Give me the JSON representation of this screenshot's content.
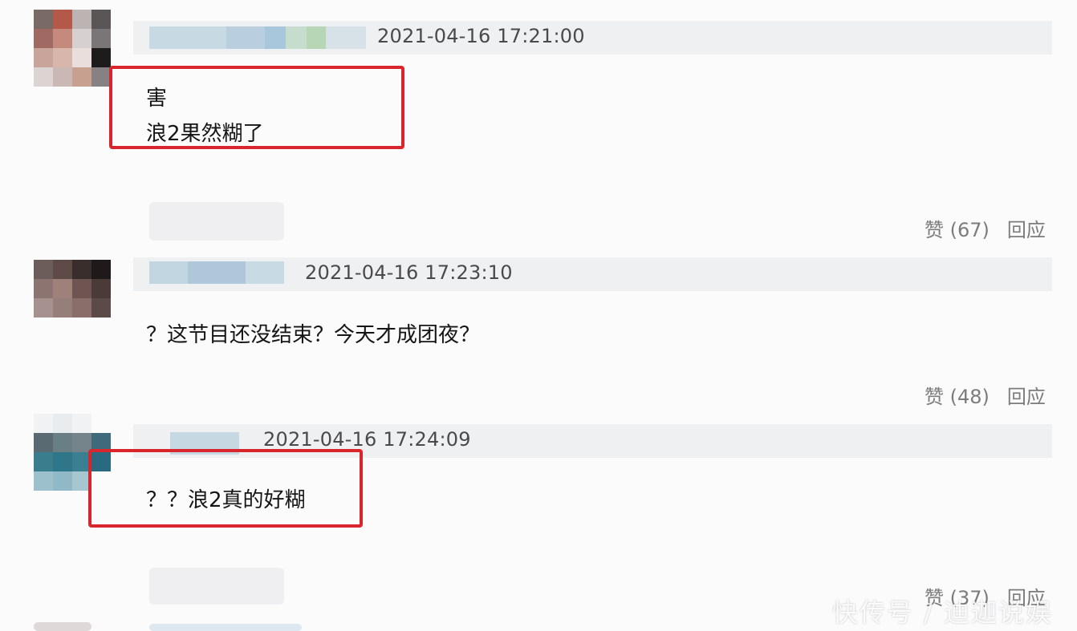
{
  "comments": [
    {
      "timestamp": "2021-04-16 17:21:00",
      "lines": [
        "害",
        "浪2果然糊了"
      ],
      "likes": "赞 (67)",
      "reply": "回应"
    },
    {
      "timestamp": "2021-04-16 17:23:10",
      "lines": [
        "？这节目还没结束？今天才成团夜？"
      ],
      "likes": "赞 (48)",
      "reply": "回应"
    },
    {
      "timestamp": "2021-04-16 17:24:09",
      "lines": [
        "？？浪2真的好糊"
      ],
      "likes": "赞 (37)",
      "reply": "回应"
    }
  ],
  "watermark": "快传号 / 迪迦说娱",
  "colors": {
    "highlight": "#d8262c",
    "header_bg": "#eef0f1",
    "meta_text": "#7c7c7c"
  }
}
